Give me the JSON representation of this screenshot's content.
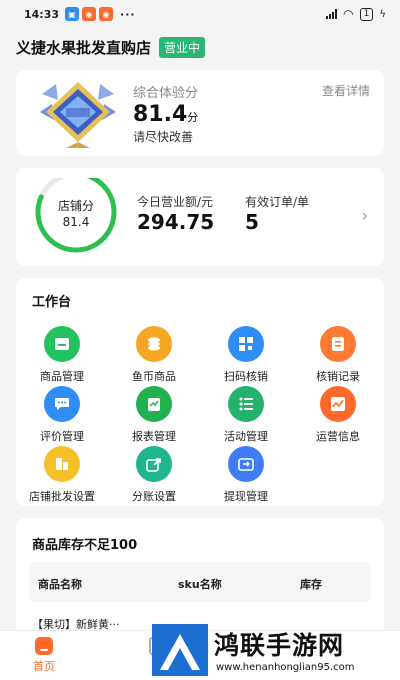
{
  "status_bar": {
    "time": "14:33",
    "dots": "···",
    "battery": "1"
  },
  "header": {
    "store_name": "义捷水果批发直购店",
    "status_badge": "营业中"
  },
  "experience": {
    "label": "综合体验分",
    "score": "81.4",
    "unit": "分",
    "hint": "请尽快改善",
    "detail_link": "查看详情"
  },
  "store_score": {
    "label": "店铺分",
    "value": "81.4",
    "fraction": 0.814,
    "revenue_label": "今日营业额/元",
    "revenue_value": "294.75",
    "orders_label": "有效订单/单",
    "orders_value": "5"
  },
  "workbench": {
    "title": "工作台",
    "items": [
      {
        "label": "商品管理",
        "icon": "product-icon",
        "color": "#22c35e"
      },
      {
        "label": "鱼币商品",
        "icon": "coin-icon",
        "color": "#f5a623"
      },
      {
        "label": "扫码核销",
        "icon": "scan-icon",
        "color": "#2f8ef5"
      },
      {
        "label": "核销记录",
        "icon": "record-icon",
        "color": "#ff7a33"
      },
      {
        "label": "评价管理",
        "icon": "comment-icon",
        "color": "#2f8ef5"
      },
      {
        "label": "报表管理",
        "icon": "report-icon",
        "color": "#22b050"
      },
      {
        "label": "活动管理",
        "icon": "list-icon",
        "color": "#23b26b"
      },
      {
        "label": "运营信息",
        "icon": "trend-icon",
        "color": "#ff6a2c"
      },
      {
        "label": "店铺批发设置",
        "icon": "store-icon",
        "color": "#f5c028"
      },
      {
        "label": "分账设置",
        "icon": "share-icon",
        "color": "#1fb58f"
      },
      {
        "label": "提现管理",
        "icon": "withdraw-icon",
        "color": "#3f7df5"
      }
    ]
  },
  "stock": {
    "title": "商品库存不足100",
    "columns": [
      "商品名称",
      "sku名称",
      "库存"
    ],
    "rows": [
      {
        "name": "【果切】新鲜黄···"
      }
    ]
  },
  "bottom_nav": {
    "home": "首页",
    "order": "订"
  },
  "watermark": {
    "title": "鸿联手游网",
    "url": "www.henanhonglian95.com"
  },
  "colors": {
    "accent": "#ff6a2c",
    "green": "#2bb673"
  }
}
